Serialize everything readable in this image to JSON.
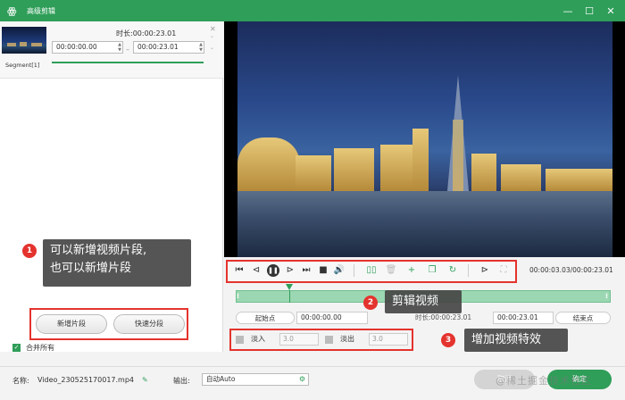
{
  "window": {
    "title": "高级剪辑"
  },
  "segment": {
    "duration_label": "时长:00:00:23.01",
    "start": "00:00:00.00",
    "end": "00:00:23.01",
    "label": "Segment[1]"
  },
  "callouts": {
    "c1_num": "1",
    "c1_line1": "可以新增视频片段,",
    "c1_line2": "也可以新增片段",
    "c2_num": "2",
    "c2_text": "剪辑视频",
    "c3_num": "3",
    "c3_text": "增加视频特效"
  },
  "left_buttons": {
    "add_segment": "新增片段",
    "quick_split": "快速分段"
  },
  "merge_all": "合并所有",
  "player": {
    "timecode": "00:00:03.03/00:00:23.01"
  },
  "trim": {
    "start_btn": "起始点",
    "start_value": "00:00:00.00",
    "duration_label": "时长:00:00:23.01",
    "end_value": "00:00:23.01",
    "end_btn": "结束点"
  },
  "effects": {
    "fade_in_label": "淡入",
    "fade_in_value": "3.0",
    "fade_out_label": "淡出",
    "fade_out_value": "3.0"
  },
  "bottom": {
    "name_label": "名称:",
    "file_name": "Video_230525170017.mp4",
    "output_label": "输出:",
    "output_value": "自动Auto",
    "cancel": "取消",
    "ok": "确定"
  },
  "watermark": "@稀土掘金技术社区",
  "colors": {
    "accent": "#2f9e59",
    "highlight": "#e4332e"
  }
}
